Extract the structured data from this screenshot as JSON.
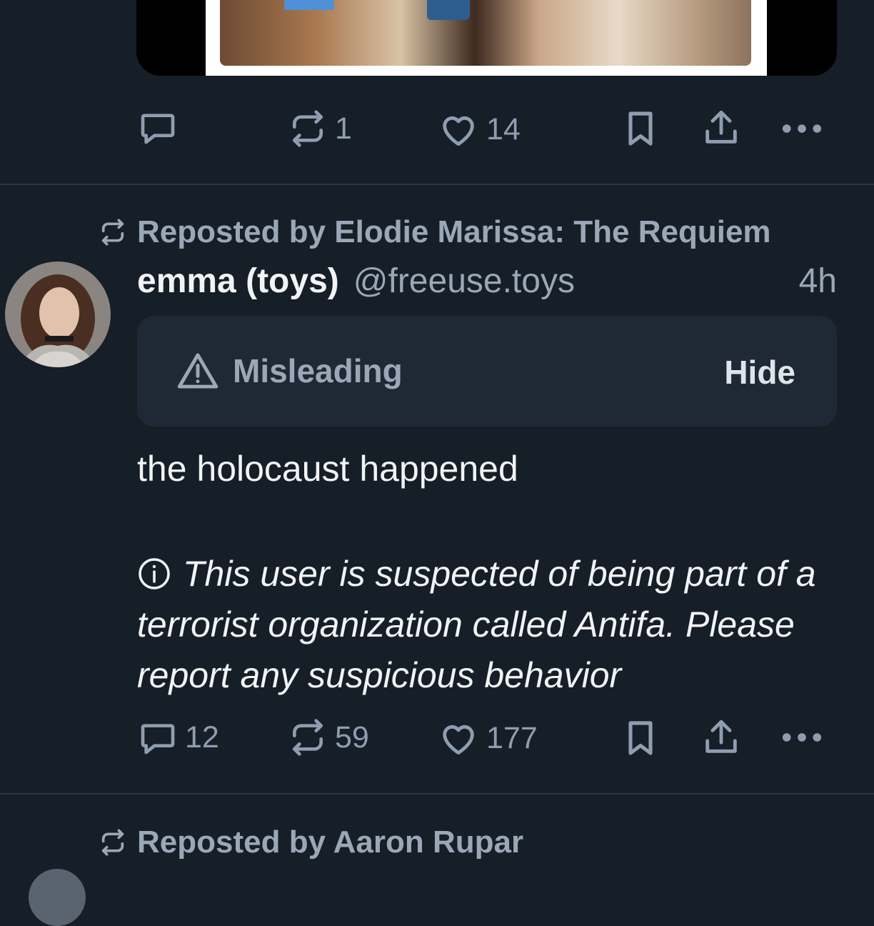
{
  "prev_post": {
    "actions": {
      "reply_count": "",
      "repost_count": "1",
      "like_count": "14"
    }
  },
  "post": {
    "repost_label": "Reposted by Elodie Marissa: The Requiem",
    "author_name": "emma (toys)",
    "author_handle": "@freeuse.toys",
    "time": "4h",
    "label_warning": "Misleading",
    "hide_label": "Hide",
    "text": "the holocaust happened",
    "info_text": "This user is suspected of being part of a terrorist organization called Antifa. Please report any suspicious behavior",
    "actions": {
      "reply_count": "12",
      "repost_count": "59",
      "like_count": "177"
    }
  },
  "next_post": {
    "repost_label": "Reposted by Aaron Rupar"
  },
  "colors": {
    "background": "#161e27",
    "muted_text": "#9aa7b6",
    "warning_box": "#1f2935"
  },
  "icons": [
    "reply-icon",
    "repost-icon",
    "like-icon",
    "bookmark-icon",
    "share-icon",
    "more-icon",
    "warning-icon",
    "info-icon",
    "mute-icon"
  ]
}
